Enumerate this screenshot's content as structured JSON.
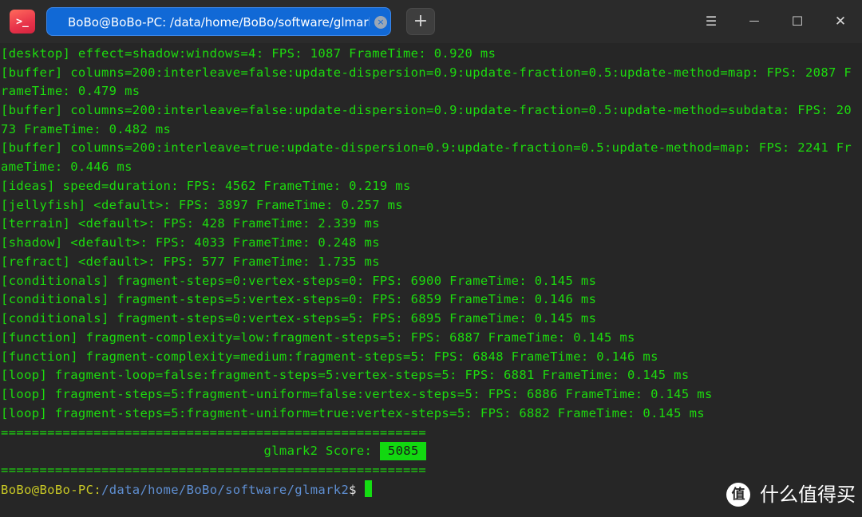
{
  "app": {
    "icon_name": "terminal-app-icon",
    "icon_glyph": ">_",
    "accent": "#1169d6"
  },
  "tab": {
    "title": "BoBo@BoBo-PC: /data/home/BoBo/software/glmark2",
    "close_glyph": "×"
  },
  "toolbar": {
    "new_tab_glyph": "+",
    "menu_glyph": "☰",
    "minimize_glyph": "—",
    "maximize_glyph": "☐",
    "close_glyph": "✕"
  },
  "output": [
    "[desktop] effect=shadow:windows=4: FPS: 1087 FrameTime: 0.920 ms",
    "[buffer] columns=200:interleave=false:update-dispersion=0.9:update-fraction=0.5:update-method=map: FPS: 2087 F",
    "rameTime: 0.479 ms",
    "[buffer] columns=200:interleave=false:update-dispersion=0.9:update-fraction=0.5:update-method=subdata: FPS: 20",
    "73 FrameTime: 0.482 ms",
    "[buffer] columns=200:interleave=true:update-dispersion=0.9:update-fraction=0.5:update-method=map: FPS: 2241 Fr",
    "ameTime: 0.446 ms",
    "[ideas] speed=duration: FPS: 4562 FrameTime: 0.219 ms",
    "[jellyfish] <default>: FPS: 3897 FrameTime: 0.257 ms",
    "[terrain] <default>: FPS: 428 FrameTime: 2.339 ms",
    "[shadow] <default>: FPS: 4033 FrameTime: 0.248 ms",
    "[refract] <default>: FPS: 577 FrameTime: 1.735 ms",
    "[conditionals] fragment-steps=0:vertex-steps=0: FPS: 6900 FrameTime: 0.145 ms",
    "[conditionals] fragment-steps=5:vertex-steps=0: FPS: 6859 FrameTime: 0.146 ms",
    "[conditionals] fragment-steps=0:vertex-steps=5: FPS: 6895 FrameTime: 0.145 ms",
    "[function] fragment-complexity=low:fragment-steps=5: FPS: 6887 FrameTime: 0.145 ms",
    "[function] fragment-complexity=medium:fragment-steps=5: FPS: 6848 FrameTime: 0.146 ms",
    "[loop] fragment-loop=false:fragment-steps=5:vertex-steps=5: FPS: 6881 FrameTime: 0.145 ms",
    "[loop] fragment-steps=5:fragment-uniform=false:vertex-steps=5: FPS: 6886 FrameTime: 0.145 ms",
    "[loop] fragment-steps=5:fragment-uniform=true:vertex-steps=5: FPS: 6882 FrameTime: 0.145 ms"
  ],
  "separator": "=======================================================",
  "score": {
    "label": "                                  glmark2 Score: ",
    "value": "5085"
  },
  "prompt": {
    "user": "BoBo@BoBo-PC",
    "colon": ":",
    "path": "/data/home/BoBo/software/glmark2",
    "dollar": "$"
  },
  "watermark": {
    "icon_glyph": "值",
    "text": "什么值得买"
  }
}
